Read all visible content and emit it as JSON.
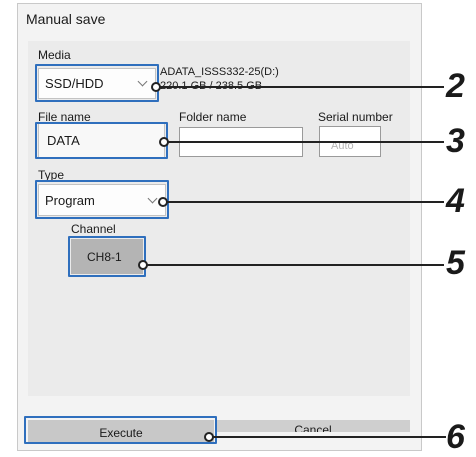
{
  "dialog": {
    "title": "Manual save",
    "media_label": "Media",
    "media_value": "SSD/HDD",
    "media_device": "ADATA_ISSS332-25(D:)",
    "media_capacity": "220.1 GB / 238.5 GB",
    "file_name_label": "File name",
    "file_name_value": "DATA",
    "folder_name_label": "Folder name",
    "folder_name_value": "",
    "serial_number_label": "Serial number",
    "serial_number_value": "Auto",
    "type_label": "Type",
    "type_value": "Program",
    "channel_label": "Channel",
    "channel_value": "CH8-1",
    "execute_label": "Execute",
    "cancel_label": "Cancel"
  },
  "callouts": {
    "media": "2",
    "file_name": "3",
    "type": "4",
    "channel": "5",
    "execute": "6"
  },
  "colors": {
    "highlight": "#2f6fbd",
    "callout_line": "#222222"
  }
}
